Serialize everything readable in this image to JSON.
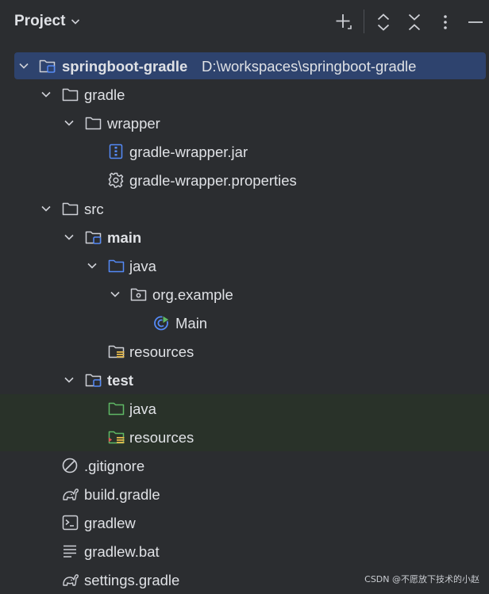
{
  "header": {
    "title": "Project",
    "buttons": [
      "add-icon",
      "expand-all-icon",
      "collapse-all-icon",
      "more-icon",
      "hide-icon"
    ]
  },
  "tree": {
    "root": {
      "label": "springboot-gradle",
      "path": "D:\\workspaces\\springboot-gradle"
    },
    "gradle": "gradle",
    "wrapper": "wrapper",
    "wrapper_jar": "gradle-wrapper.jar",
    "wrapper_props": "gradle-wrapper.properties",
    "src": "src",
    "main": "main",
    "main_java": "java",
    "org_example": "org.example",
    "main_class": "Main",
    "main_resources": "resources",
    "test": "test",
    "test_java": "java",
    "test_resources": "resources",
    "gitignore": ".gitignore",
    "build_gradle": "build.gradle",
    "gradlew": "gradlew",
    "gradlew_bat": "gradlew.bat",
    "settings_gradle": "settings.gradle"
  },
  "watermark": "CSDN @不愿放下技术的小赵",
  "colors": {
    "background": "#2b2d30",
    "selection": "#2e436e",
    "test_highlight": "#293229",
    "source_folder": "#548af7",
    "test_folder": "#5fb865"
  }
}
